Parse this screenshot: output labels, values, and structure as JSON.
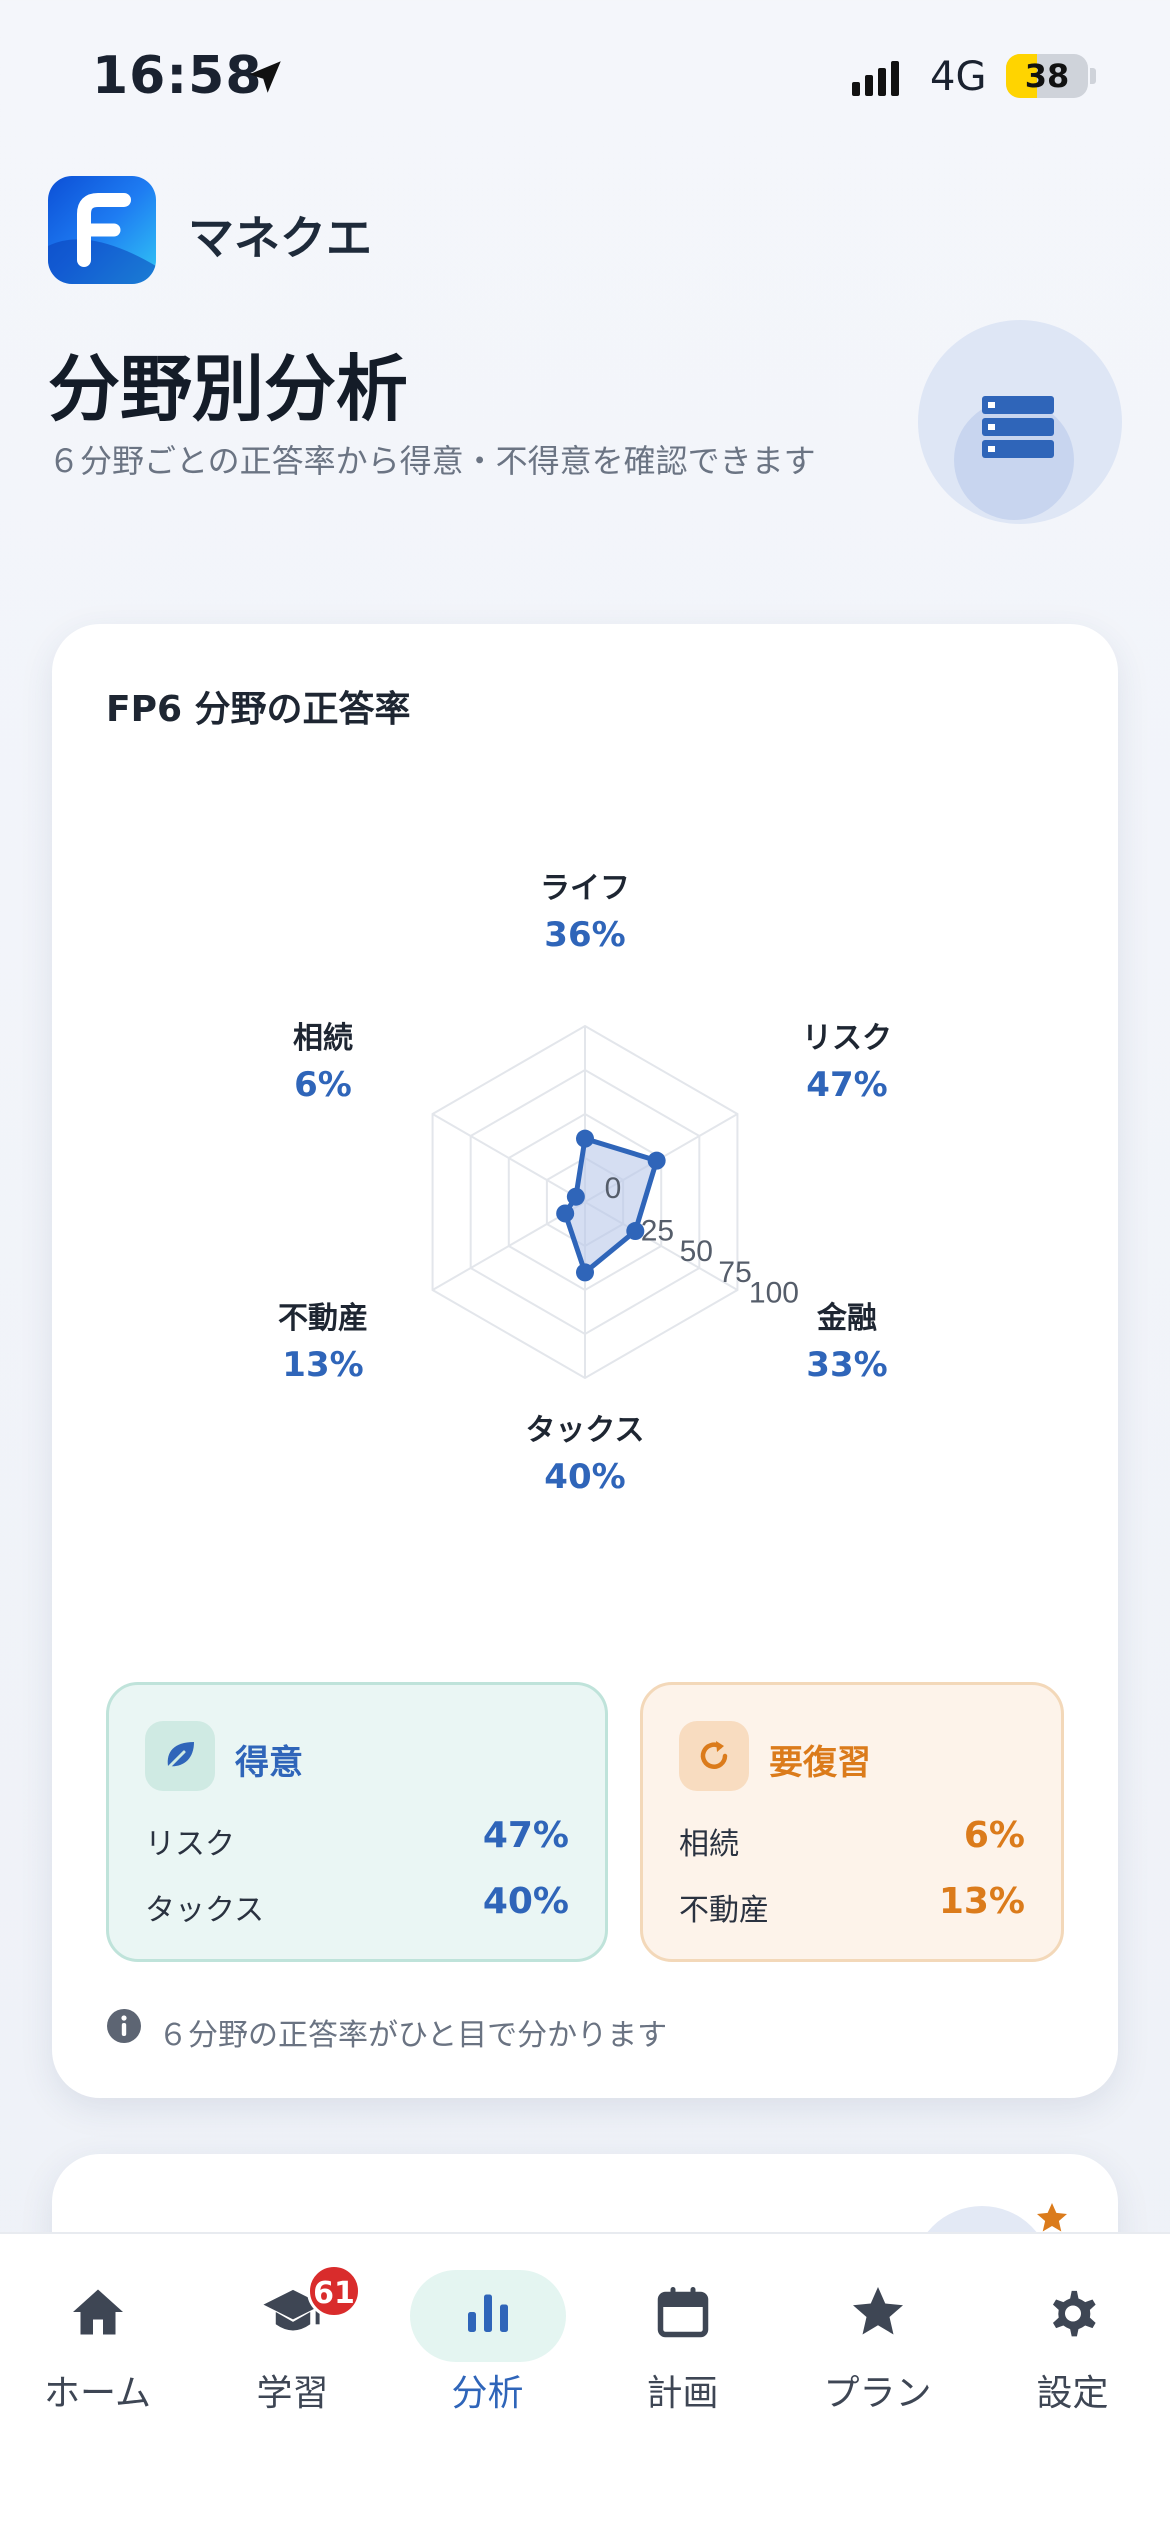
{
  "status_bar": {
    "time": "16:58",
    "network": "4G",
    "battery_level": "38",
    "battery_fraction": 0.38,
    "battery_color": "#ffd400"
  },
  "app": {
    "name": "マネクエ",
    "logo_letter_icon": "f-letter-logo-icon"
  },
  "page": {
    "title": "分野別分析",
    "subtitle": "６分野ごとの正答率から得意・不得意を確認できます",
    "hero_icon": "database-icon"
  },
  "card": {
    "title": "FP6 分野の正答率"
  },
  "chart_data": {
    "type": "radar",
    "title": "FP6 分野の正答率",
    "axes": [
      "ライフ",
      "リスク",
      "金融",
      "タックス",
      "不動産",
      "相続"
    ],
    "values": [
      36,
      47,
      33,
      40,
      13,
      6
    ],
    "value_labels": [
      "36%",
      "47%",
      "33%",
      "40%",
      "13%",
      "6%"
    ],
    "ticks": [
      0,
      25,
      50,
      75,
      100
    ],
    "tick_labels": [
      "0",
      "25",
      "50",
      "75",
      "100"
    ],
    "range": [
      0,
      100
    ],
    "colors": {
      "fill": "#b9c8ea",
      "stroke": "#2f65b9",
      "grid": "#e3e6eb",
      "value_text": "#2f65b9",
      "label_text": "#1e2632",
      "tick_text": "#555d6a"
    }
  },
  "summary": {
    "strong": {
      "title": "得意",
      "icon": "leaf-icon",
      "items": [
        {
          "label": "リスク",
          "value": "47%"
        },
        {
          "label": "タックス",
          "value": "40%"
        }
      ]
    },
    "review": {
      "title": "要復習",
      "icon": "refresh-icon",
      "items": [
        {
          "label": "相続",
          "value": "6%"
        },
        {
          "label": "不動産",
          "value": "13%"
        }
      ]
    }
  },
  "info_note": "６分野の正答率がひと目で分かります",
  "tab_bar": {
    "tabs": [
      {
        "label": "ホーム",
        "icon": "home-icon"
      },
      {
        "label": "学習",
        "icon": "graduation-cap-icon",
        "badge": "61"
      },
      {
        "label": "分析",
        "icon": "bar-chart-icon",
        "active": true
      },
      {
        "label": "計画",
        "icon": "calendar-icon"
      },
      {
        "label": "プラン",
        "icon": "star-icon"
      },
      {
        "label": "設定",
        "icon": "gear-icon"
      }
    ],
    "active_color": "#2f65b9",
    "badge_color": "#d92c2c"
  }
}
